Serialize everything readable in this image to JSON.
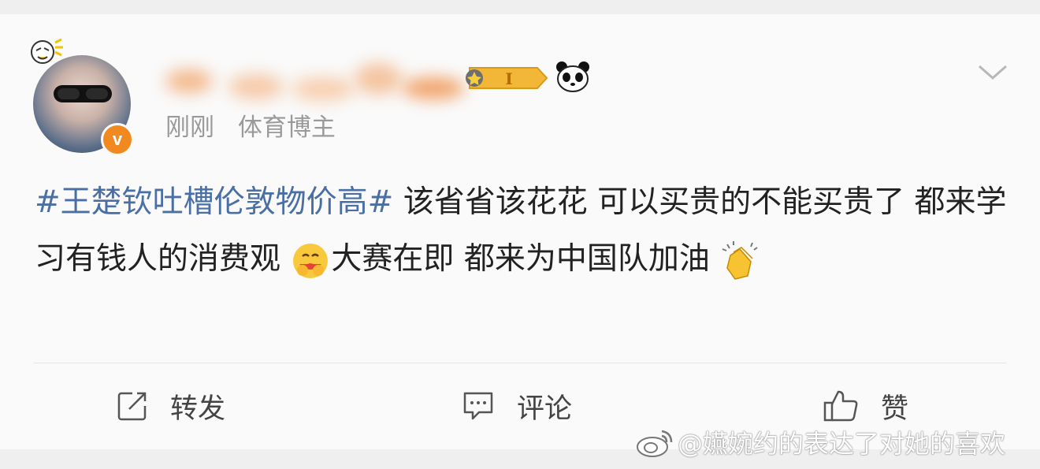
{
  "post": {
    "timestamp": "刚刚",
    "author_tag": "体育博主",
    "topic": "#王楚钦吐槽伦敦物价高#",
    "text_1": " 该省省该花花 可以买贵的不能买贵了 都来学习有钱人的消费观",
    "text_2": "大赛在即 都来为中国队加油",
    "verified_badge": "v",
    "level_badge": "I"
  },
  "actions": {
    "repost": "转发",
    "comment": "评论",
    "like": "赞"
  },
  "watermark": "@嬿婉约的表达了对她的喜欢",
  "colors": {
    "topic": "#4a6fa5",
    "verified": "#f08a20",
    "level_badge": "#f2b736"
  },
  "icons": [
    "avatar-pendant-icon",
    "level-badge-icon",
    "panda-icon",
    "chevron-down-icon",
    "hug-emoji-icon",
    "clap-emoji-icon",
    "repost-icon",
    "comment-icon",
    "like-icon",
    "weibo-logo-icon"
  ]
}
